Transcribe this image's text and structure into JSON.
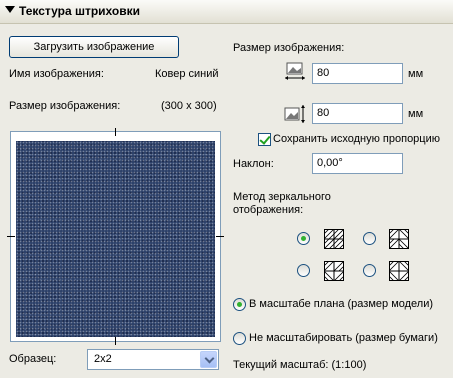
{
  "section": {
    "title": "Текстура штриховки"
  },
  "left": {
    "load_button": "Загрузить изображение",
    "image_name_label": "Имя изображения:",
    "image_name_value": "Ковер синий",
    "image_size_label": "Размер изображения:",
    "image_size_value": "(300 x 300)",
    "sample_label": "Образец:",
    "sample_value": "2x2"
  },
  "right": {
    "size_label": "Размер изображения:",
    "width_value": "80",
    "height_value": "80",
    "unit": "мм",
    "keep_ratio_label": "Сохранить исходную пропорцию",
    "keep_ratio_checked": true,
    "angle_label": "Наклон:",
    "angle_value": "0,00°",
    "mirror_label_line1": "Метод зеркального",
    "mirror_label_line2": "отображения:",
    "mirror_selected": 0,
    "scale_option_plan": "В масштабе плана (размер модели)",
    "scale_option_paper": "Не масштабировать (размер бумаги)",
    "scale_selected": "plan",
    "current_scale": "Текущий масштаб: (1:100)"
  },
  "icons": {
    "width_icon": "image-width-icon",
    "height_icon": "image-height-icon",
    "mirror_icons": [
      "mirror-none-icon",
      "mirror-horizontal-icon",
      "mirror-vertical-icon",
      "mirror-both-icon"
    ]
  },
  "colors": {
    "texture": "#2d4169",
    "radio_on": "#31b131",
    "border": "#7f9db9"
  }
}
